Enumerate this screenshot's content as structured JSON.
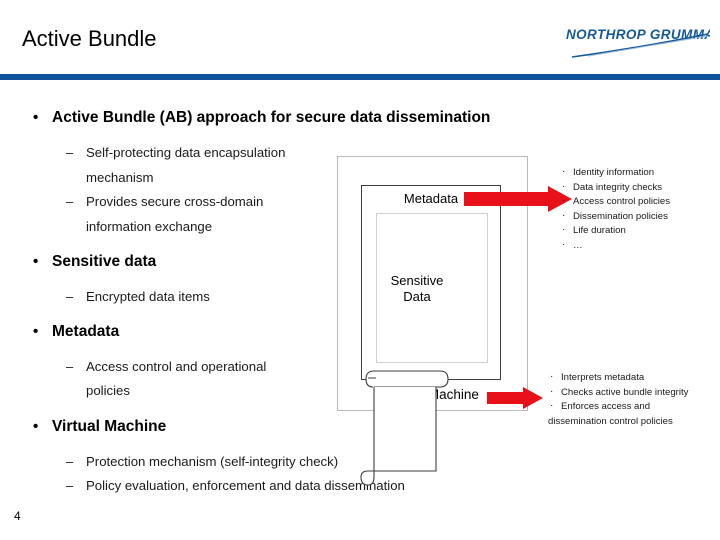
{
  "header": {
    "title": "Active Bundle",
    "logo_text": "NORTHROP GRUMMAN",
    "rule_color": "#0f5499",
    "logo_color": "#14599b"
  },
  "bullets": [
    {
      "level": 1,
      "text": "Active Bundle (AB) approach for secure data dissemination",
      "marker": "•"
    },
    {
      "level": 2,
      "text": "Self-protecting data encapsulation",
      "marker": "–"
    },
    {
      "level": 2,
      "text": "mechanism",
      "marker": ""
    },
    {
      "level": 2,
      "text": "Provides secure cross-domain",
      "marker": "–"
    },
    {
      "level": 2,
      "text": "information exchange",
      "marker": ""
    },
    {
      "level": 1,
      "text": "Sensitive data",
      "marker": "•"
    },
    {
      "level": 2,
      "text": "Encrypted data items",
      "marker": "–"
    },
    {
      "level": 1,
      "text": "Metadata",
      "marker": "•"
    },
    {
      "level": 2,
      "text": "Access control and operational",
      "marker": "–"
    },
    {
      "level": 2,
      "text": "policies",
      "marker": ""
    },
    {
      "level": 1,
      "text": "Virtual Machine",
      "marker": "•"
    },
    {
      "level": 2,
      "text": "Protection mechanism (self-integrity check)",
      "marker": "–"
    },
    {
      "level": 2,
      "text": "Policy evaluation, enforcement and data dissemination",
      "marker": "–"
    }
  ],
  "diagram": {
    "outer_label": "Virtual Machine",
    "middle_label": "Metadata",
    "inner_label_line1": "Sensitive",
    "inner_label_line2": "Data",
    "arrow_color": "#e8111a"
  },
  "callouts": {
    "metadata": {
      "marker": "·",
      "items": [
        "Identity information",
        "Data integrity checks",
        "Access control policies",
        "Dissemination policies",
        "Life duration",
        "…"
      ]
    },
    "virtual_machine": {
      "marker": "·",
      "items": [
        "Interprets metadata",
        "Checks active bundle integrity",
        "Enforces access and"
      ],
      "wrapped_line": "dissemination control policies"
    }
  },
  "footer": {
    "slide_number": "4"
  }
}
